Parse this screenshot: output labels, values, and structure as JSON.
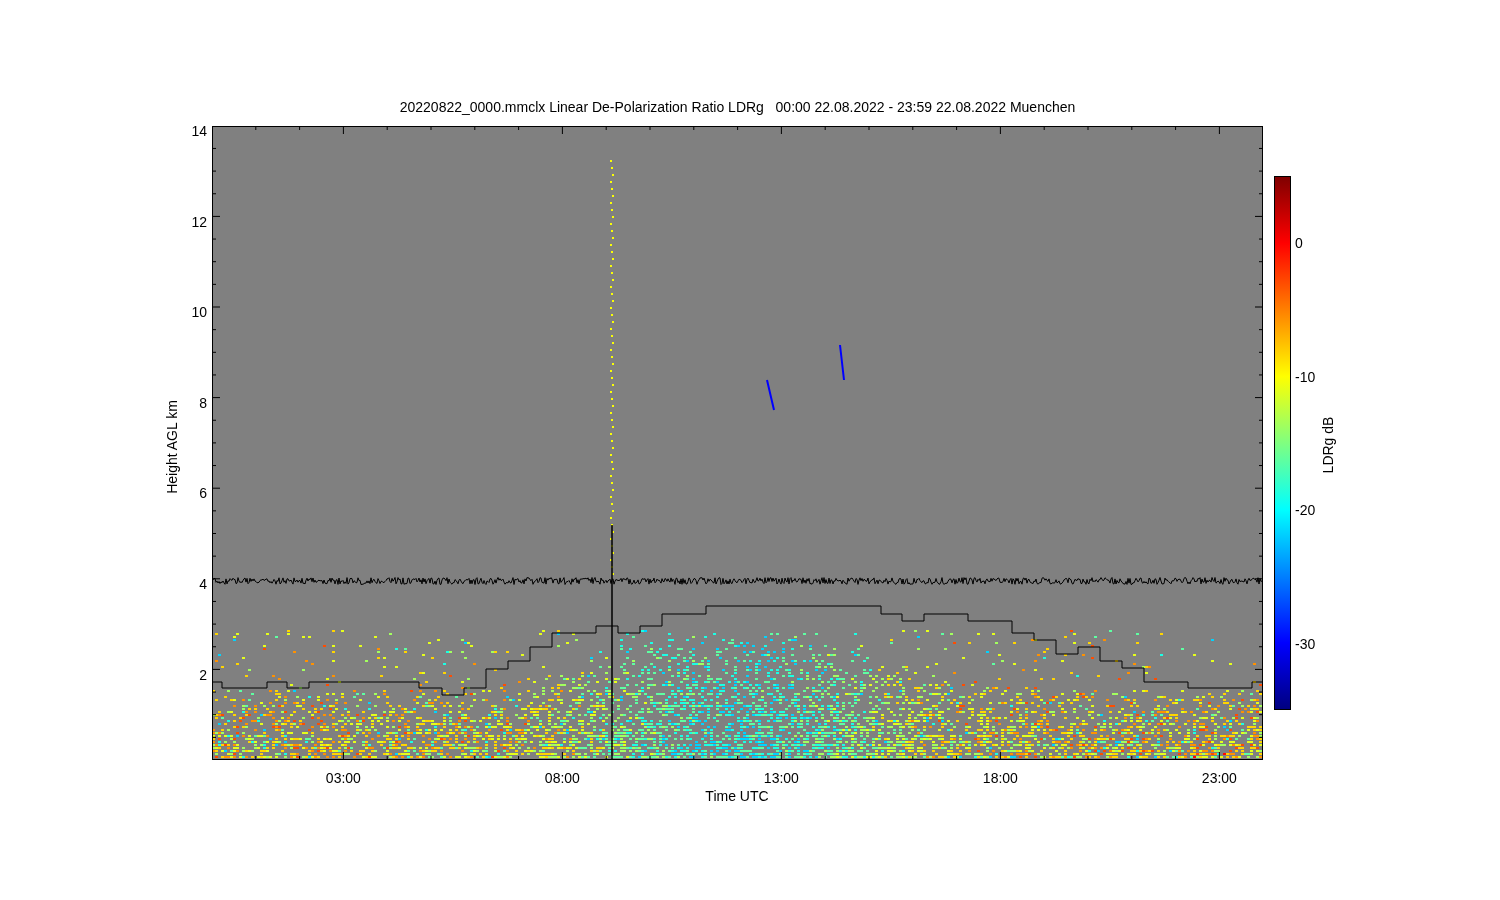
{
  "title": "20220822_0000.mmclx Linear De-Polarization Ratio LDRg   00:00 22.08.2022 - 23:59 22.08.2022 Muenchen",
  "y_axis": {
    "label": "Height AGL km",
    "ticks": [
      "14",
      "12",
      "10",
      "8",
      "6",
      "4",
      "2"
    ]
  },
  "x_axis": {
    "label": "Time UTC",
    "ticks": [
      "03:00",
      "08:00",
      "13:00",
      "18:00",
      "23:00"
    ]
  },
  "colorbar": {
    "label": "LDRg dB",
    "ticks": [
      "0",
      "-10",
      "-20",
      "-30"
    ]
  }
}
